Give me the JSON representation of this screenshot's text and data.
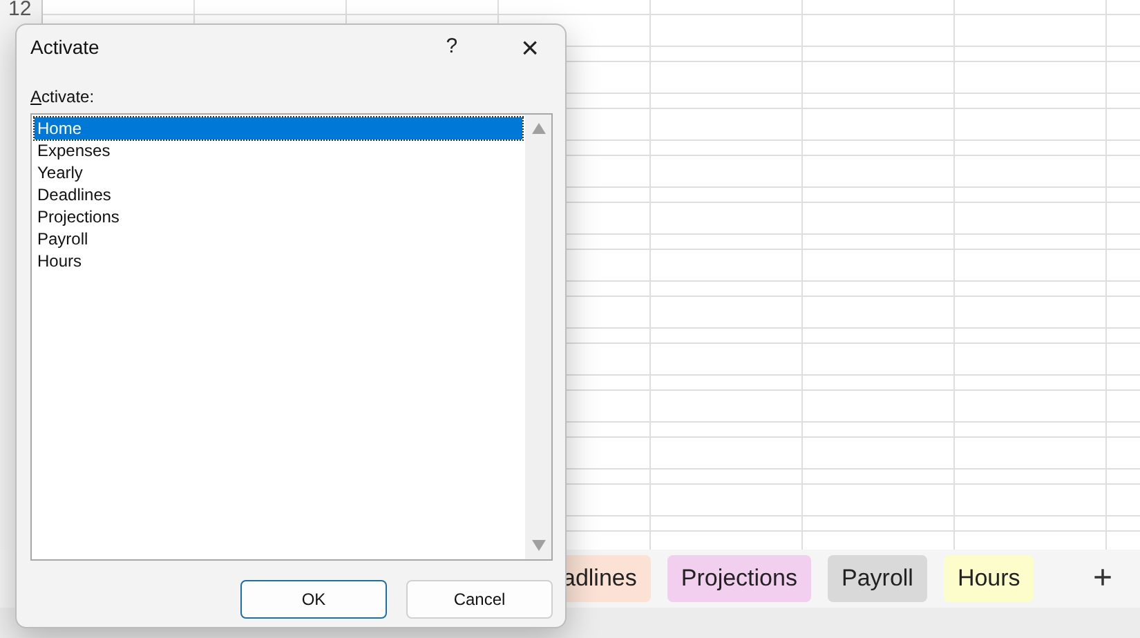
{
  "sheet": {
    "row_header": "12"
  },
  "sheet_tabs": [
    {
      "label": "adlines",
      "color": "#fbe2d5"
    },
    {
      "label": "Projections",
      "color": "#f2cfee"
    },
    {
      "label": "Payroll",
      "color": "#d9d9d9"
    },
    {
      "label": "Hours",
      "color": "#fdfdcc"
    }
  ],
  "add_sheet": "+",
  "dialog": {
    "title": "Activate",
    "help": "?",
    "close": "×",
    "list_label": "**A**ctivate:",
    "items": [
      {
        "label": "Home",
        "selected": true
      },
      {
        "label": "Expenses",
        "selected": false
      },
      {
        "label": "Yearly",
        "selected": false
      },
      {
        "label": "Deadlines",
        "selected": false
      },
      {
        "label": "Projections",
        "selected": false
      },
      {
        "label": "Payroll",
        "selected": false
      },
      {
        "label": "Hours",
        "selected": false
      }
    ],
    "buttons": [
      {
        "label": "OK",
        "kind": "default"
      },
      {
        "label": "Cancel",
        "kind": "normal"
      }
    ]
  }
}
